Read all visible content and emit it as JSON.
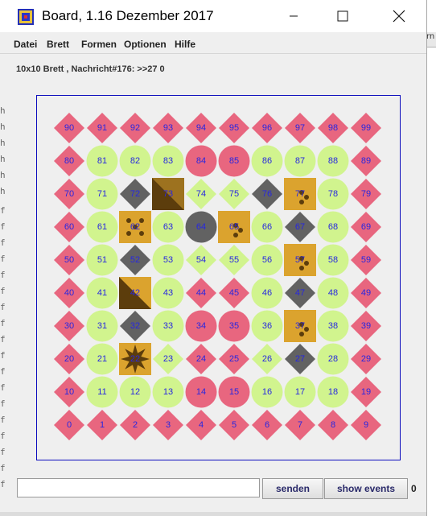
{
  "window": {
    "title": "Board, 1.16 Dezember 2017",
    "buttons": [
      "minimize",
      "maximize",
      "close"
    ]
  },
  "menu": {
    "items": [
      {
        "label": "Datei"
      },
      {
        "label": "Brett"
      },
      {
        "label": "Formen"
      },
      {
        "label": "Optionen"
      },
      {
        "label": "Hilfe"
      }
    ]
  },
  "status_line": "10x10 Brett , Nachricht#176: >>27 0",
  "background_window": {
    "right_edge_text": "rn",
    "left_edge_chars": [
      "h",
      "h",
      "h",
      "h",
      "h",
      "h",
      "f",
      "f",
      "f",
      "f",
      "f",
      "f",
      "f",
      "f",
      "f",
      "f",
      "f",
      "f",
      "f",
      "f",
      "f",
      "f",
      "f",
      "f"
    ]
  },
  "colors": {
    "pink": "#e8667f",
    "green": "#d1f48e",
    "gray": "#626262",
    "gold": "#dba32e",
    "dark": "#5c3d0c",
    "number": "#2727e0",
    "frame": "#0b0bbd"
  },
  "board": {
    "size": "10x10",
    "rows": [
      [
        {
          "n": "90",
          "shape": "diamond",
          "color": "pink"
        },
        {
          "n": "91",
          "shape": "diamond",
          "color": "pink"
        },
        {
          "n": "92",
          "shape": "diamond",
          "color": "pink"
        },
        {
          "n": "93",
          "shape": "diamond",
          "color": "pink"
        },
        {
          "n": "94",
          "shape": "diamond",
          "color": "pink"
        },
        {
          "n": "95",
          "shape": "diamond",
          "color": "pink"
        },
        {
          "n": "96",
          "shape": "diamond",
          "color": "pink"
        },
        {
          "n": "97",
          "shape": "diamond",
          "color": "pink"
        },
        {
          "n": "98",
          "shape": "diamond",
          "color": "pink"
        },
        {
          "n": "99",
          "shape": "diamond",
          "color": "pink"
        }
      ],
      [
        {
          "n": "80",
          "shape": "diamond",
          "color": "pink"
        },
        {
          "n": "81",
          "shape": "circle",
          "color": "green"
        },
        {
          "n": "82",
          "shape": "circle",
          "color": "green"
        },
        {
          "n": "83",
          "shape": "circle",
          "color": "green"
        },
        {
          "n": "84",
          "shape": "circle",
          "color": "pink"
        },
        {
          "n": "85",
          "shape": "circle",
          "color": "pink"
        },
        {
          "n": "86",
          "shape": "circle",
          "color": "green"
        },
        {
          "n": "87",
          "shape": "circle",
          "color": "green"
        },
        {
          "n": "88",
          "shape": "circle",
          "color": "green"
        },
        {
          "n": "89",
          "shape": "diamond",
          "color": "pink"
        }
      ],
      [
        {
          "n": "70",
          "shape": "diamond",
          "color": "pink"
        },
        {
          "n": "71",
          "shape": "circle",
          "color": "green"
        },
        {
          "n": "72",
          "shape": "diamond",
          "color": "gray"
        },
        {
          "n": "73",
          "shape": "square",
          "color": "gold",
          "overlay": "triangle-up"
        },
        {
          "n": "74",
          "shape": "diamond",
          "color": "green"
        },
        {
          "n": "75",
          "shape": "diamond",
          "color": "green"
        },
        {
          "n": "76",
          "shape": "diamond",
          "color": "gray"
        },
        {
          "n": "77",
          "shape": "square",
          "color": "gold",
          "overlay": "dots3"
        },
        {
          "n": "78",
          "shape": "circle",
          "color": "green"
        },
        {
          "n": "79",
          "shape": "diamond",
          "color": "pink"
        }
      ],
      [
        {
          "n": "60",
          "shape": "diamond",
          "color": "pink"
        },
        {
          "n": "61",
          "shape": "circle",
          "color": "green"
        },
        {
          "n": "62",
          "shape": "square",
          "color": "gold",
          "overlay": "dots5"
        },
        {
          "n": "63",
          "shape": "circle",
          "color": "green"
        },
        {
          "n": "64",
          "shape": "circle",
          "color": "gray"
        },
        {
          "n": "65",
          "shape": "square",
          "color": "gold",
          "overlay": "dots3"
        },
        {
          "n": "66",
          "shape": "circle",
          "color": "green"
        },
        {
          "n": "67",
          "shape": "diamond",
          "color": "gray"
        },
        {
          "n": "68",
          "shape": "circle",
          "color": "green"
        },
        {
          "n": "69",
          "shape": "diamond",
          "color": "pink"
        }
      ],
      [
        {
          "n": "50",
          "shape": "diamond",
          "color": "pink"
        },
        {
          "n": "51",
          "shape": "circle",
          "color": "green"
        },
        {
          "n": "52",
          "shape": "diamond",
          "color": "gray"
        },
        {
          "n": "53",
          "shape": "circle",
          "color": "green"
        },
        {
          "n": "54",
          "shape": "diamond",
          "color": "green"
        },
        {
          "n": "55",
          "shape": "diamond",
          "color": "green"
        },
        {
          "n": "56",
          "shape": "circle",
          "color": "green"
        },
        {
          "n": "57",
          "shape": "square",
          "color": "gold",
          "overlay": "dots3"
        },
        {
          "n": "58",
          "shape": "circle",
          "color": "green"
        },
        {
          "n": "59",
          "shape": "diamond",
          "color": "pink"
        }
      ],
      [
        {
          "n": "40",
          "shape": "diamond",
          "color": "pink"
        },
        {
          "n": "41",
          "shape": "circle",
          "color": "green"
        },
        {
          "n": "42",
          "shape": "square",
          "color": "gold",
          "overlay": "triangle-down"
        },
        {
          "n": "43",
          "shape": "circle",
          "color": "green"
        },
        {
          "n": "44",
          "shape": "diamond",
          "color": "pink"
        },
        {
          "n": "45",
          "shape": "diamond",
          "color": "pink"
        },
        {
          "n": "46",
          "shape": "circle",
          "color": "green"
        },
        {
          "n": "47",
          "shape": "diamond",
          "color": "gray"
        },
        {
          "n": "48",
          "shape": "circle",
          "color": "green"
        },
        {
          "n": "49",
          "shape": "diamond",
          "color": "pink"
        }
      ],
      [
        {
          "n": "30",
          "shape": "diamond",
          "color": "pink"
        },
        {
          "n": "31",
          "shape": "circle",
          "color": "green"
        },
        {
          "n": "32",
          "shape": "diamond",
          "color": "gray"
        },
        {
          "n": "33",
          "shape": "circle",
          "color": "green"
        },
        {
          "n": "34",
          "shape": "circle",
          "color": "pink"
        },
        {
          "n": "35",
          "shape": "circle",
          "color": "pink"
        },
        {
          "n": "36",
          "shape": "circle",
          "color": "green"
        },
        {
          "n": "37",
          "shape": "square",
          "color": "gold",
          "overlay": "dots3"
        },
        {
          "n": "38",
          "shape": "circle",
          "color": "green"
        },
        {
          "n": "39",
          "shape": "diamond",
          "color": "pink"
        }
      ],
      [
        {
          "n": "20",
          "shape": "diamond",
          "color": "pink"
        },
        {
          "n": "21",
          "shape": "circle",
          "color": "green"
        },
        {
          "n": "22",
          "shape": "square",
          "color": "gold",
          "overlay": "star"
        },
        {
          "n": "23",
          "shape": "diamond",
          "color": "green"
        },
        {
          "n": "24",
          "shape": "diamond",
          "color": "pink"
        },
        {
          "n": "25",
          "shape": "diamond",
          "color": "pink"
        },
        {
          "n": "26",
          "shape": "diamond",
          "color": "green"
        },
        {
          "n": "27",
          "shape": "diamond",
          "color": "gray"
        },
        {
          "n": "28",
          "shape": "circle",
          "color": "green"
        },
        {
          "n": "29",
          "shape": "diamond",
          "color": "pink"
        }
      ],
      [
        {
          "n": "10",
          "shape": "diamond",
          "color": "pink"
        },
        {
          "n": "11",
          "shape": "circle",
          "color": "green"
        },
        {
          "n": "12",
          "shape": "circle",
          "color": "green"
        },
        {
          "n": "13",
          "shape": "circle",
          "color": "green"
        },
        {
          "n": "14",
          "shape": "circle",
          "color": "pink"
        },
        {
          "n": "15",
          "shape": "circle",
          "color": "pink"
        },
        {
          "n": "16",
          "shape": "circle",
          "color": "green"
        },
        {
          "n": "17",
          "shape": "circle",
          "color": "green"
        },
        {
          "n": "18",
          "shape": "circle",
          "color": "green"
        },
        {
          "n": "19",
          "shape": "diamond",
          "color": "pink"
        }
      ],
      [
        {
          "n": "0",
          "shape": "diamond",
          "color": "pink"
        },
        {
          "n": "1",
          "shape": "diamond",
          "color": "pink"
        },
        {
          "n": "2",
          "shape": "diamond",
          "color": "pink"
        },
        {
          "n": "3",
          "shape": "diamond",
          "color": "pink"
        },
        {
          "n": "4",
          "shape": "diamond",
          "color": "pink"
        },
        {
          "n": "5",
          "shape": "diamond",
          "color": "pink"
        },
        {
          "n": "6",
          "shape": "diamond",
          "color": "pink"
        },
        {
          "n": "7",
          "shape": "diamond",
          "color": "pink"
        },
        {
          "n": "8",
          "shape": "diamond",
          "color": "pink"
        },
        {
          "n": "9",
          "shape": "diamond",
          "color": "pink"
        }
      ]
    ]
  },
  "footer": {
    "input_value": "",
    "send_label": "senden",
    "show_events_label": "show events",
    "counter": "0"
  }
}
